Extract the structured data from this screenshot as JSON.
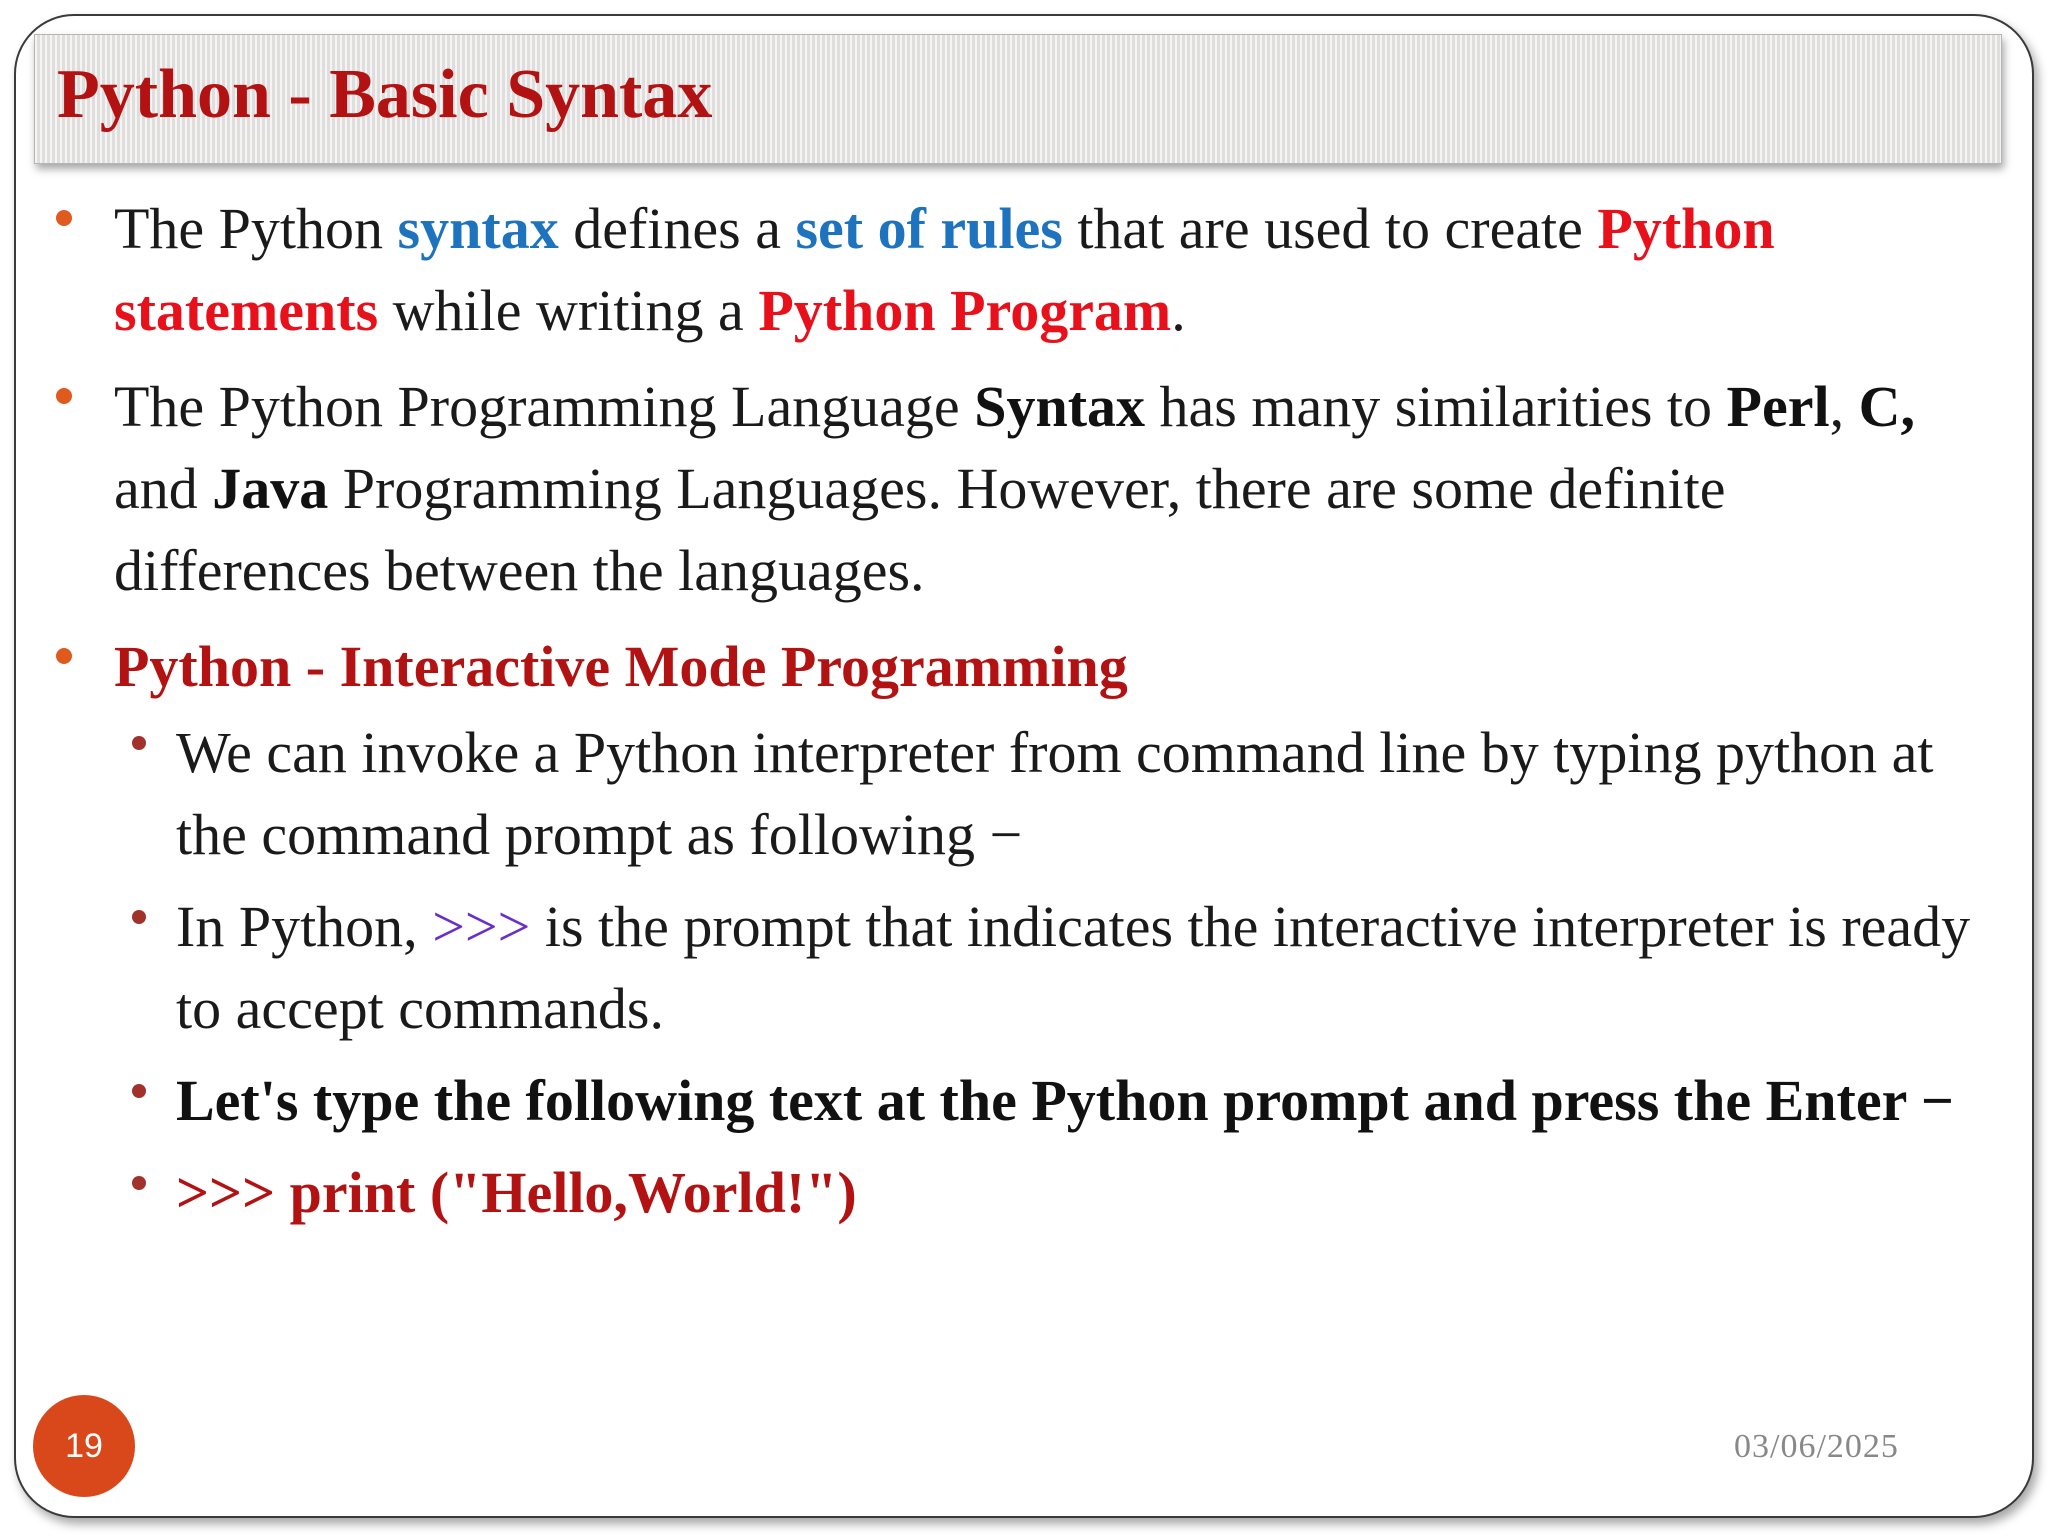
{
  "slide": {
    "title": "Python - Basic Syntax",
    "page_number": "19",
    "date": "03/06/2025"
  },
  "bullets": {
    "b1": {
      "p1": " The Python ",
      "k1": "syntax",
      "p2": " defines a ",
      "k2": "set of rules",
      "p3": " that are used to create ",
      "k3": "Python statements",
      "p4": " while writing a ",
      "k4": "Python Program",
      "p5": "."
    },
    "b2": {
      "p1": "The Python Programming Language ",
      "k1": "Syntax",
      "p2": " has many similarities to ",
      "k2": "Perl",
      "p3": ", ",
      "k3": "C,",
      "p4": " and ",
      "k4": "Java",
      "p5": " Programming Languages. However, there are some definite differences between the languages."
    },
    "b3": {
      "heading": "Python - Interactive Mode Programming"
    }
  },
  "subbullets": {
    "s1": "We can invoke a Python interpreter from command line by typing python at the command prompt as following −",
    "s2": {
      "p1": "In Python, ",
      "k1": ">>>",
      "p2": " is the prompt that indicates the interactive interpreter is ready to accept commands."
    },
    "s3": "Let's type the following text at the Python prompt and press the Enter −",
    "s4": ">>> print (\"Hello,World!\")"
  },
  "colors": {
    "title_red": "#b31212",
    "highlight_blue": "#1e73be",
    "highlight_red": "#e8111b",
    "prompt_purple": "#6a2fc8",
    "bullet_orange": "#e05a1f",
    "page_badge": "#d9481b"
  }
}
